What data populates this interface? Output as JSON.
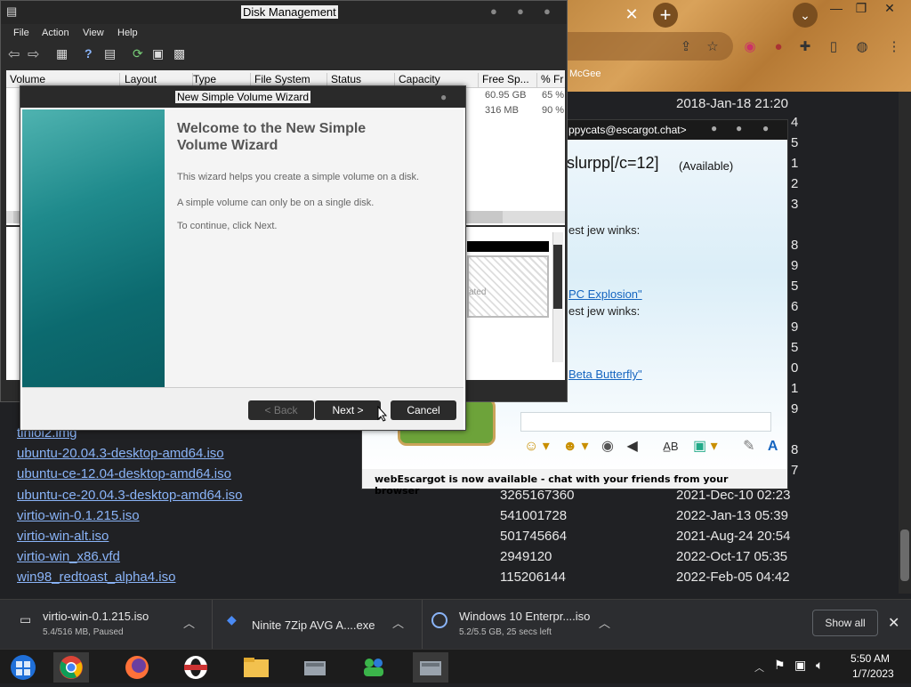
{
  "chrome": {
    "tab_close_glyph": "✕",
    "new_tab_glyph": "+",
    "tab_search_glyph": "⌄",
    "bookmark_label": "McGee",
    "window_controls": [
      "—",
      "❐",
      "✕"
    ]
  },
  "listing": {
    "rows": [
      {
        "name": "",
        "size": "",
        "date": "2018-Jan-18 21:20"
      },
      {
        "name": "tinioi2.img",
        "size": "",
        "date": ""
      },
      {
        "name": "ubuntu-20.04.3-desktop-amd64.iso",
        "size": "",
        "date": ""
      },
      {
        "name": "ubuntu-ce-12.04-desktop-amd64.iso",
        "size": "",
        "date": ""
      },
      {
        "name": "ubuntu-ce-20.04.3-desktop-amd64.iso",
        "size": "3265167360",
        "date": "2021-Dec-10 02:23"
      },
      {
        "name": "virtio-win-0.1.215.iso",
        "size": "541001728",
        "date": "2022-Jan-13 05:39"
      },
      {
        "name": "virtio-win-alt.iso",
        "size": "501745664",
        "date": "2021-Aug-24 20:54"
      },
      {
        "name": "virtio-win_x86.vfd",
        "size": "2949120",
        "date": "2022-Oct-17 05:35"
      },
      {
        "name": "win98_redtoast_alpha4.iso",
        "size": "115206144",
        "date": "2022-Feb-05 04:42"
      }
    ],
    "partial_digits": [
      "4",
      "5",
      "1",
      "2",
      "3",
      "8",
      "9",
      "5",
      "6",
      "9",
      "5",
      "0",
      "1",
      "9",
      "8",
      "7"
    ]
  },
  "chat": {
    "title": "ppycats@escargot.chat>",
    "contact_name": "slurpp[/c=12]",
    "contact_status": "(Available)",
    "msg1": "est jew winks:",
    "link1": "PC Explosion\"",
    "msg2": "est jew winks:",
    "link2": "Beta Butterfly\"",
    "status_text": "webEscargot is now available - chat with your friends from your browser"
  },
  "disk_mgmt": {
    "title": "Disk Management",
    "menu": [
      "File",
      "Action",
      "View",
      "Help"
    ],
    "columns": [
      "Volume",
      "Layout",
      "Type",
      "File System",
      "Status",
      "Capacity",
      "Free Sp...",
      "% Fr"
    ],
    "rows": [
      {
        "free": "60.95 GB",
        "pct": "65 %"
      },
      {
        "free": "316 MB",
        "pct": "90 %"
      }
    ],
    "lower_text": "ated"
  },
  "wizard": {
    "title": "New Simple Volume Wizard",
    "heading": "Welcome to the New Simple Volume Wizard",
    "line1": "This wizard helps you create a simple volume on a disk.",
    "line2": "A simple volume can only be on a single disk.",
    "line3": "To continue, click Next.",
    "back_label": "< Back",
    "next_label": "Next >",
    "cancel_label": "Cancel"
  },
  "downloads": {
    "items": [
      {
        "name": "virtio-win-0.1.215.iso",
        "sub": "5.4/516 MB, Paused"
      },
      {
        "name": "Ninite 7Zip AVG A....exe",
        "sub": ""
      },
      {
        "name": "Windows 10 Enterpr....iso",
        "sub": "5.2/5.5 GB, 25 secs left"
      }
    ],
    "show_all_label": "Show all",
    "close_glyph": "✕"
  },
  "taskbar": {
    "time": "5:50 AM",
    "date": "1/7/2023"
  }
}
